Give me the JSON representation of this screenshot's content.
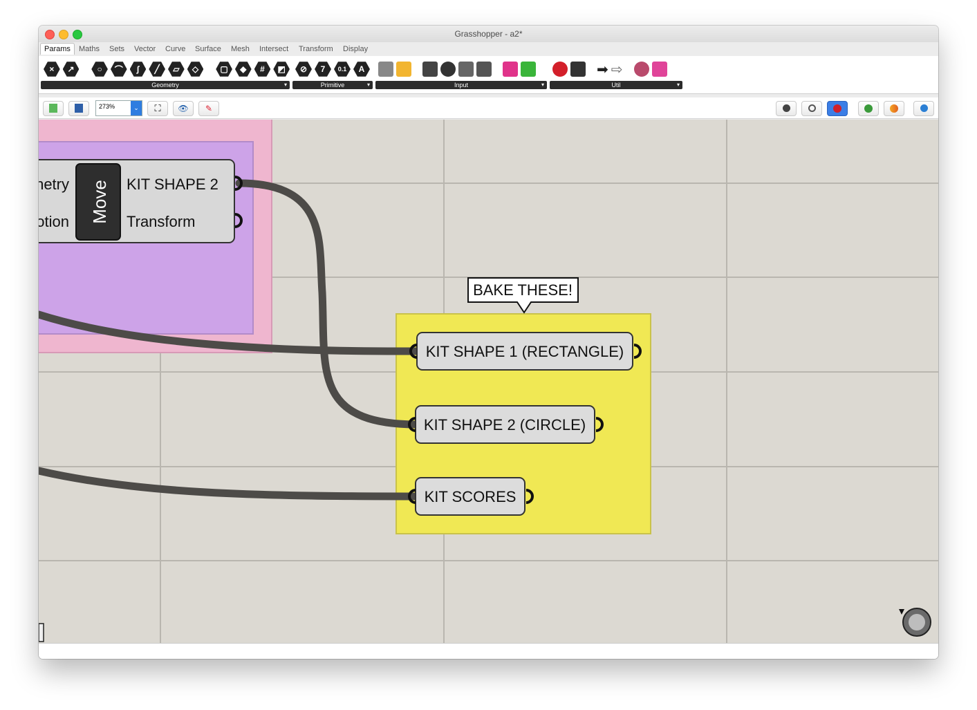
{
  "window": {
    "title": "Grasshopper - a2*"
  },
  "menu_tabs": [
    "Params",
    "Maths",
    "Sets",
    "Vector",
    "Curve",
    "Surface",
    "Mesh",
    "Intersect",
    "Transform",
    "Display"
  ],
  "ribbon_groups": [
    {
      "label": "Geometry"
    },
    {
      "label": "Primitive"
    },
    {
      "label": "Input"
    },
    {
      "label": "Util"
    }
  ],
  "primitive_icons": [
    "7",
    "0.1",
    "A"
  ],
  "toolbar": {
    "zoom": "273%"
  },
  "canvas": {
    "move_component": {
      "name": "Move",
      "input_labels": [
        "netry",
        "otion"
      ],
      "output_labels": [
        "KIT SHAPE 2",
        "Transform"
      ]
    },
    "scribble": "BAKE THESE!",
    "params": [
      {
        "label": "KIT SHAPE 1 (RECTANGLE)"
      },
      {
        "label": "KIT SHAPE 2 (CIRCLE)"
      },
      {
        "label": "KIT SCORES"
      }
    ],
    "group_colors": {
      "pink": "#efb6cf",
      "purple": "#cda3e8",
      "yellow": "#f0e854"
    }
  }
}
